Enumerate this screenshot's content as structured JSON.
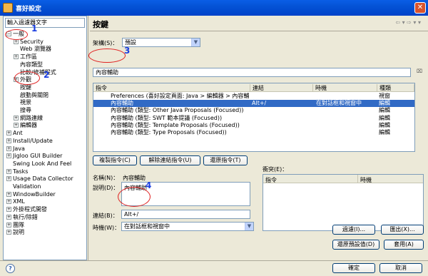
{
  "window": {
    "title": "喜好設定",
    "close_glyph": "✕"
  },
  "left": {
    "filter_placeholder": "輸入過濾器文字",
    "tree": [
      {
        "label": "一般",
        "indent": 0,
        "exp": "−"
      },
      {
        "label": "Security",
        "indent": 1,
        "exp": "+"
      },
      {
        "label": "Web 瀏覽器",
        "indent": 1,
        "exp": ""
      },
      {
        "label": "工作區",
        "indent": 1,
        "exp": "+"
      },
      {
        "label": "內容類型",
        "indent": 1,
        "exp": ""
      },
      {
        "label": "比較/修補程式",
        "indent": 1,
        "exp": ""
      },
      {
        "label": "外觀",
        "indent": 1,
        "exp": "+"
      },
      {
        "label": "按鍵",
        "indent": 1,
        "exp": ""
      },
      {
        "label": "啟動與關閉",
        "indent": 1,
        "exp": ""
      },
      {
        "label": "視景",
        "indent": 1,
        "exp": ""
      },
      {
        "label": "搜尋",
        "indent": 1,
        "exp": ""
      },
      {
        "label": "網路連線",
        "indent": 1,
        "exp": "+"
      },
      {
        "label": "編輯器",
        "indent": 1,
        "exp": "+"
      },
      {
        "label": "Ant",
        "indent": 0,
        "exp": "+"
      },
      {
        "label": "Install/Update",
        "indent": 0,
        "exp": "+"
      },
      {
        "label": "Java",
        "indent": 0,
        "exp": "+"
      },
      {
        "label": "Jigloo GUI Builder",
        "indent": 0,
        "exp": "+"
      },
      {
        "label": "Swing Look And Feel",
        "indent": 0,
        "exp": ""
      },
      {
        "label": "Tasks",
        "indent": 0,
        "exp": "+"
      },
      {
        "label": "Usage Data Collector",
        "indent": 0,
        "exp": "+"
      },
      {
        "label": "Validation",
        "indent": 0,
        "exp": ""
      },
      {
        "label": "WindowBuilder",
        "indent": 0,
        "exp": "+"
      },
      {
        "label": "XML",
        "indent": 0,
        "exp": "+"
      },
      {
        "label": "外掛程式開發",
        "indent": 0,
        "exp": "+"
      },
      {
        "label": "執行/除錯",
        "indent": 0,
        "exp": "+"
      },
      {
        "label": "團隊",
        "indent": 0,
        "exp": "+"
      },
      {
        "label": "說明",
        "indent": 0,
        "exp": "+"
      }
    ]
  },
  "main": {
    "heading": "按鍵",
    "nav_icons": "⇦ ▾ ⇨ ▾ ▾",
    "scheme_label": "架構(S)：",
    "scheme_value": "預設",
    "filter_value": "內容輔助",
    "columns": [
      "指令",
      "連結",
      "時機",
      "種類"
    ],
    "rows": [
      {
        "cmd": "Preferences (喜好設定頁面: Java > 編輯器 > 內容輔助)",
        "bind": "",
        "when": "",
        "cat": "視窗",
        "selected": false
      },
      {
        "cmd": "內容輔助",
        "bind": "Alt+/",
        "when": "在對話框和視窗中",
        "cat": "編輯",
        "selected": true
      },
      {
        "cmd": "內容輔助 (類型: Other Java Proposals (Focused))",
        "bind": "",
        "when": "",
        "cat": "編輯",
        "selected": false
      },
      {
        "cmd": "內容輔助 (類型: SWT 範本提議 (Focused))",
        "bind": "",
        "when": "",
        "cat": "編輯",
        "selected": false
      },
      {
        "cmd": "內容輔助 (類型: Template Proposals (Focused))",
        "bind": "",
        "when": "",
        "cat": "編輯",
        "selected": false
      },
      {
        "cmd": "內容輔助 (類型: Type Proposals (Focused))",
        "bind": "",
        "when": "",
        "cat": "編輯",
        "selected": false
      }
    ],
    "copy_btn": "複製指令(C)",
    "unbind_btn": "解除連結指令(U)",
    "restore_cmd_btn": "還原指令(T)",
    "name_label": "名稱(N)：",
    "name_value": "內容輔助",
    "desc_label": "說明(D)：",
    "desc_value": "內容輔助",
    "binding_label": "連結(B)：",
    "binding_value": "Alt+/",
    "when_label": "時機(W)：",
    "when_value": "在對話框和視窗中",
    "conflicts_label": "衝突(E)：",
    "conflict_columns": [
      "指令",
      "時機"
    ],
    "filter_btn": "過濾(I)...",
    "export_btn": "匯出(X)...",
    "restore_defaults_btn": "還原預設值(D)",
    "apply_btn": "套用(A)"
  },
  "footer": {
    "ok": "確定",
    "cancel": "取消",
    "help_glyph": "?"
  },
  "annotations": [
    "1",
    "2",
    "3",
    "4"
  ]
}
